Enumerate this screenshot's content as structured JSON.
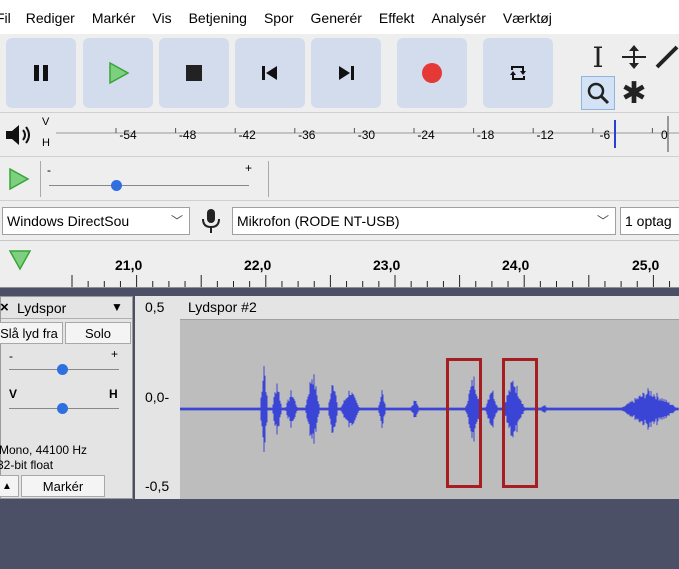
{
  "menu": [
    "Fil",
    "Rediger",
    "Markér",
    "Vis",
    "Betjening",
    "Spor",
    "Generér",
    "Effekt",
    "Analysér",
    "Værktøj"
  ],
  "transport": {
    "pause": "pause-icon",
    "play": "play-icon",
    "stop": "stop-icon",
    "skip_start": "skip-to-start-icon",
    "skip_end": "skip-to-end-icon",
    "record": "record-icon",
    "loop": "loop-icon",
    "colors": {
      "button_bg": "#d3dced",
      "play": "#3aa33a",
      "record": "#e53935"
    }
  },
  "tools": {
    "select": "I",
    "envelope": "envelope-icon",
    "draw": "draw-icon",
    "zoom": "zoom-icon",
    "multi": "✱"
  },
  "meter": {
    "v_label": "V",
    "h_label": "H",
    "ticks": [
      "-54",
      "-48",
      "-42",
      "-36",
      "-30",
      "-24",
      "-18",
      "-12",
      "-6",
      "0"
    ],
    "marker_color": "#2a3fd8"
  },
  "playback_speed": {
    "minus": "-",
    "plus": "+"
  },
  "devices": {
    "host": "Windows DirectSou",
    "mic": "Mikrofon (RODE NT-USB)",
    "channels": "1 optag"
  },
  "timeline": {
    "labels": [
      "21,0",
      "22,0",
      "23,0",
      "24,0",
      "25,0"
    ]
  },
  "track": {
    "name": "Lydspor",
    "close": "×",
    "mute": "Slå lyd fra",
    "solo": "Solo",
    "gain_minus": "-",
    "gain_plus": "+",
    "pan_left": "V",
    "pan_right": "H",
    "format_line1": "Mono, 44100 Hz",
    "format_line2": "32-bit float",
    "select": "Markér",
    "clip_name": "Lydspor #2",
    "scale": {
      "top": "0,5",
      "mid": "0,0-",
      "bottom": "-0,5"
    },
    "wave_color": "#3a45d6"
  }
}
